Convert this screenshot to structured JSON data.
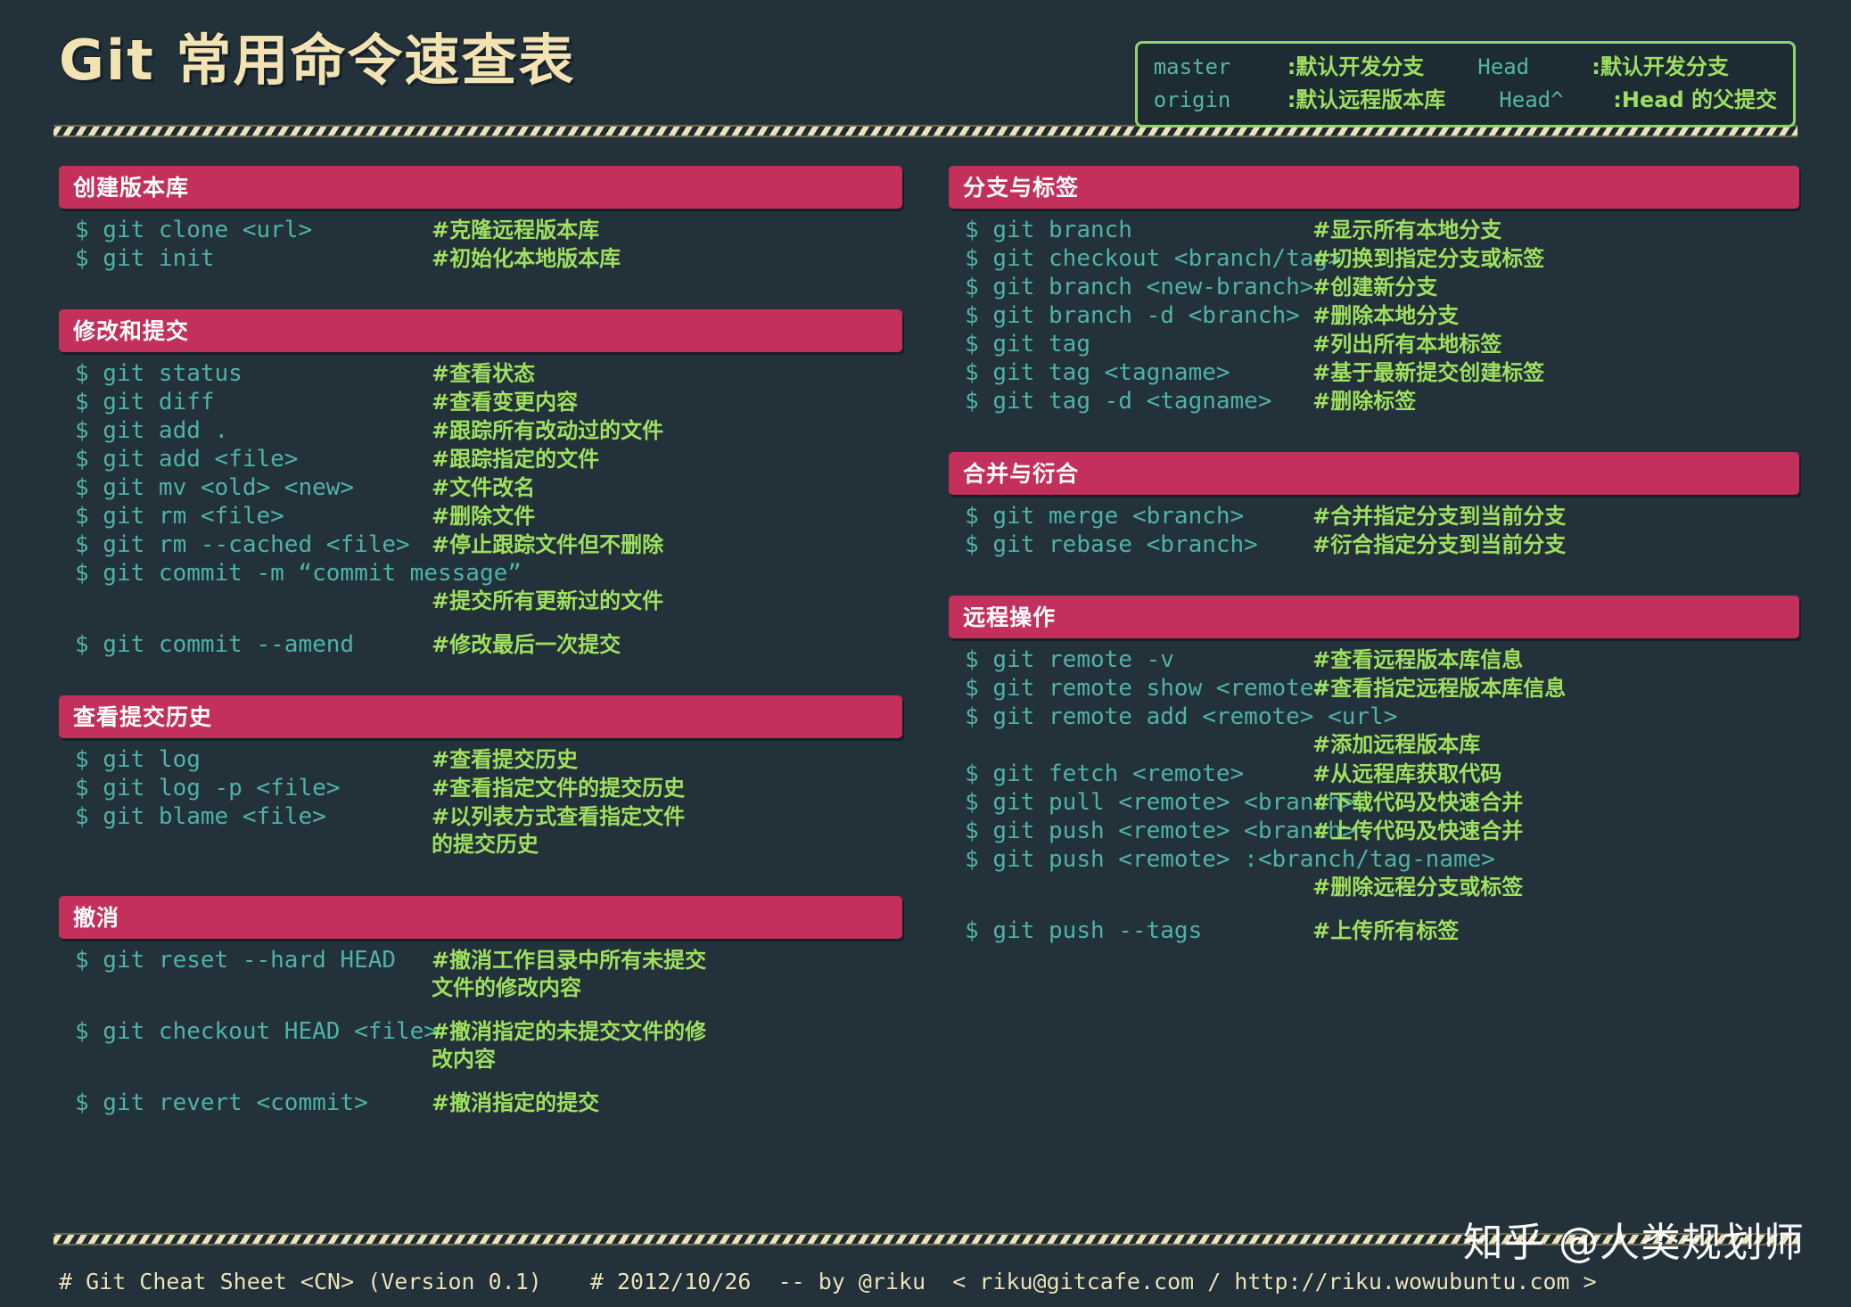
{
  "title": "Git 常用命令速查表",
  "colors": {
    "background": "#22313a",
    "title": "#f3e3b2",
    "section_header_bg": "#c4305c",
    "command": "#4fb3a3",
    "comment": "#9fe05f",
    "legend_border": "#8fd36a",
    "stripe": "#ece3bb"
  },
  "legend": {
    "rows": [
      {
        "key1": "master",
        "val1": ":默认开发分支",
        "key2": "Head",
        "val2": ":默认开发分支"
      },
      {
        "key1": "origin",
        "val1": ":默认远程版本库",
        "key2": "Head^",
        "val2": ":Head 的父提交"
      }
    ]
  },
  "left_column": [
    {
      "heading": "创建版本库",
      "rows": [
        {
          "cmd": "$ git clone <url>",
          "cmt": "#克隆远程版本库"
        },
        {
          "cmd": "$ git init",
          "cmt": "#初始化本地版本库"
        }
      ]
    },
    {
      "heading": "修改和提交",
      "rows": [
        {
          "cmd": "$ git status",
          "cmt": "#查看状态"
        },
        {
          "cmd": "$ git diff",
          "cmt": "#查看变更内容"
        },
        {
          "cmd": "$ git add .",
          "cmt": "#跟踪所有改动过的文件"
        },
        {
          "cmd": "$ git add <file>",
          "cmt": "#跟踪指定的文件"
        },
        {
          "cmd": "$ git mv <old> <new>",
          "cmt": "#文件改名"
        },
        {
          "cmd": "$ git rm <file>",
          "cmt": "#删除文件"
        },
        {
          "cmd": "$ git rm --cached <file>",
          "cmt": "#停止跟踪文件但不删除"
        },
        {
          "cmd": "$ git commit -m “commit message”",
          "cmt": "",
          "wide": true
        },
        {
          "cmd": "",
          "cmt": "#提交所有更新过的文件"
        },
        {
          "cmd": "",
          "cmt": "",
          "spacer": true
        },
        {
          "cmd": "$ git commit --amend",
          "cmt": "#修改最后一次提交"
        }
      ]
    },
    {
      "heading": "查看提交历史",
      "rows": [
        {
          "cmd": "$ git log",
          "cmt": "#查看提交历史"
        },
        {
          "cmd": "$ git log -p <file>",
          "cmt": "#查看指定文件的提交历史"
        },
        {
          "cmd": "$ git blame <file>",
          "cmt": "#以列表方式查看指定文件"
        },
        {
          "cmd": "",
          "cmt": "的提交历史"
        }
      ]
    },
    {
      "heading": "撤消",
      "rows": [
        {
          "cmd": "$ git reset --hard HEAD",
          "cmt": "#撤消工作目录中所有未提交"
        },
        {
          "cmd": "",
          "cmt": "文件的修改内容"
        },
        {
          "cmd": "",
          "cmt": "",
          "spacer": true
        },
        {
          "cmd": "$ git checkout HEAD <file>",
          "cmt": "#撤消指定的未提交文件的修"
        },
        {
          "cmd": "",
          "cmt": "改内容"
        },
        {
          "cmd": "",
          "cmt": "",
          "spacer": true
        },
        {
          "cmd": "$ git revert <commit>",
          "cmt": "#撤消指定的提交"
        }
      ]
    }
  ],
  "right_column": [
    {
      "heading": "分支与标签",
      "rows": [
        {
          "cmd": "$ git branch",
          "cmt": "#显示所有本地分支"
        },
        {
          "cmd": "$ git checkout <branch/tag>",
          "cmt": "#切换到指定分支或标签"
        },
        {
          "cmd": "$ git branch <new-branch>",
          "cmt": "#创建新分支"
        },
        {
          "cmd": "$ git branch -d <branch>",
          "cmt": "#删除本地分支"
        },
        {
          "cmd": "$ git tag",
          "cmt": "#列出所有本地标签"
        },
        {
          "cmd": "$ git tag <tagname>",
          "cmt": "#基于最新提交创建标签"
        },
        {
          "cmd": "$ git tag -d <tagname>",
          "cmt": "#删除标签"
        }
      ]
    },
    {
      "heading": "合并与衍合",
      "rows": [
        {
          "cmd": "$ git merge <branch>",
          "cmt": "#合并指定分支到当前分支"
        },
        {
          "cmd": "$ git rebase <branch>",
          "cmt": "#衍合指定分支到当前分支"
        }
      ]
    },
    {
      "heading": "远程操作",
      "rows": [
        {
          "cmd": "$ git remote -v",
          "cmt": "#查看远程版本库信息"
        },
        {
          "cmd": "$ git remote show <remote>",
          "cmt": "#查看指定远程版本库信息"
        },
        {
          "cmd": "$ git remote add <remote> <url>",
          "cmt": "",
          "wide": true
        },
        {
          "cmd": "",
          "cmt": "#添加远程版本库"
        },
        {
          "cmd": "$ git fetch <remote>",
          "cmt": "#从远程库获取代码"
        },
        {
          "cmd": "$ git pull <remote> <branch>",
          "cmt": "#下载代码及快速合并"
        },
        {
          "cmd": "$ git push <remote> <branch>",
          "cmt": "#上传代码及快速合并"
        },
        {
          "cmd": "$ git push <remote> :<branch/tag-name>",
          "cmt": "",
          "wide": true
        },
        {
          "cmd": "",
          "cmt": "#删除远程分支或标签"
        },
        {
          "cmd": "",
          "cmt": "",
          "spacer": true
        },
        {
          "cmd": "$ git push --tags",
          "cmt": "#上传所有标签"
        }
      ]
    }
  ],
  "footer": {
    "left": "# Git Cheat Sheet <CN> (Version 0.1)",
    "right": "# 2012/10/26  -- by @riku  < riku@gitcafe.com / http://riku.wowubuntu.com >"
  },
  "watermark": "知乎 @人类规划师"
}
